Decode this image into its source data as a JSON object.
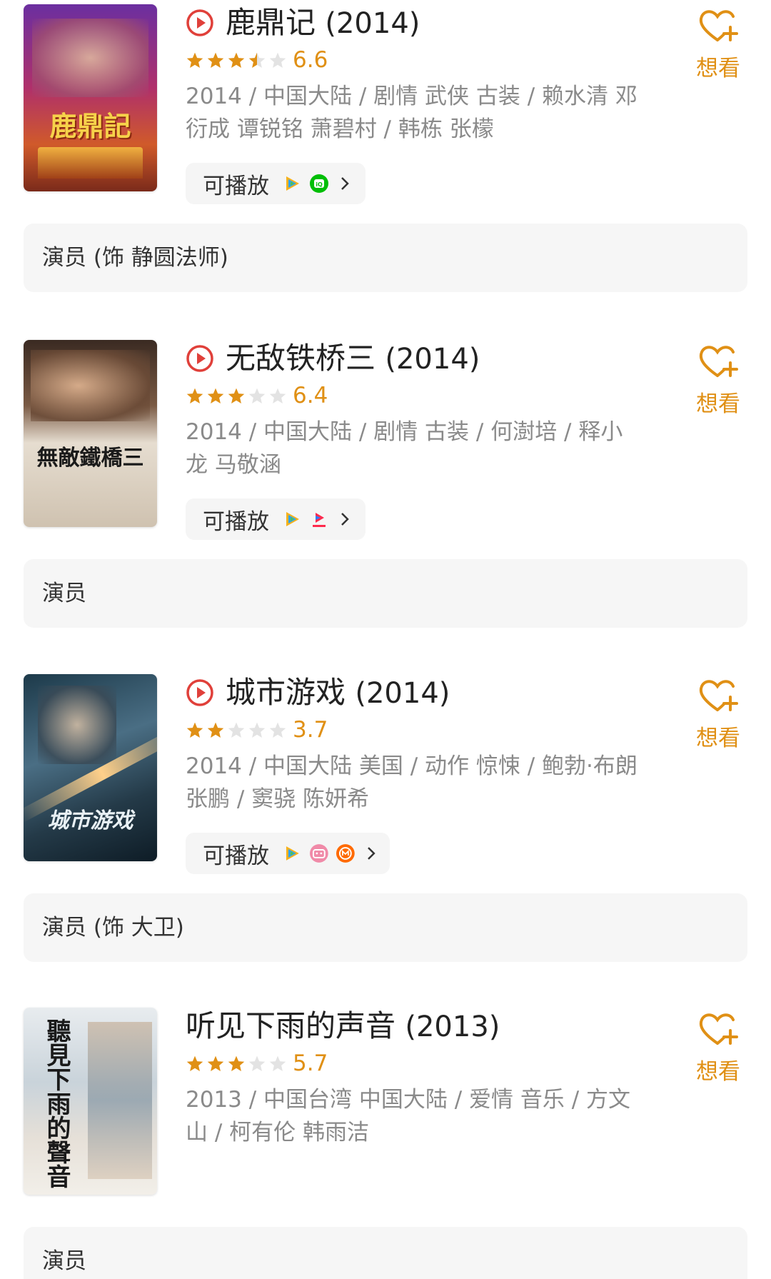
{
  "colors": {
    "accent": "#e09015",
    "play_red": "#e0403a",
    "meta_gray": "#8a8a8a",
    "panel_bg": "#f6f6f6"
  },
  "items": [
    {
      "title": "鹿鼎记",
      "year": "(2014)",
      "has_play_icon": true,
      "rating": "6.6",
      "stars": 3.5,
      "meta": "2014 / 中国大陆 / 剧情 武侠 古装 / 赖水清 邓衍成 谭锐铭 萧碧村 / 韩栋 张檬",
      "playable_label": "可播放",
      "sources": [
        "tencent-video-icon",
        "iqiyi-icon"
      ],
      "want_label": "想看",
      "role": "演员 (饰 静圆法师)",
      "poster_text": "鹿鼎記"
    },
    {
      "title": "无敌铁桥三",
      "year": "(2014)",
      "has_play_icon": true,
      "rating": "6.4",
      "stars": 3,
      "meta": "2014 / 中国大陆 / 剧情 古装 / 何澍培 / 释小龙 马敬涵",
      "playable_label": "可播放",
      "sources": [
        "tencent-video-icon",
        "youku-icon"
      ],
      "want_label": "想看",
      "role": "演员",
      "poster_text": "無敵鐵橋三"
    },
    {
      "title": "城市游戏",
      "year": "(2014)",
      "has_play_icon": true,
      "rating": "3.7",
      "stars": 2,
      "meta": "2014 / 中国大陆 美国 / 动作 惊悚 / 鲍勃·布朗 张鹏 / 窦骁 陈妍希",
      "playable_label": "可播放",
      "sources": [
        "tencent-video-icon",
        "bilibili-icon",
        "mango-tv-icon"
      ],
      "want_label": "想看",
      "role": "演员 (饰 大卫)",
      "poster_text": "城市游戏"
    },
    {
      "title": "听见下雨的声音",
      "year": "(2013)",
      "has_play_icon": false,
      "rating": "5.7",
      "stars": 3,
      "meta": "2013 / 中国台湾 中国大陆 / 爱情 音乐 / 方文山 / 柯有伦 韩雨洁",
      "playable_label": "",
      "sources": [],
      "want_label": "想看",
      "role": "演员",
      "poster_text": "聽見下雨的聲音"
    }
  ]
}
